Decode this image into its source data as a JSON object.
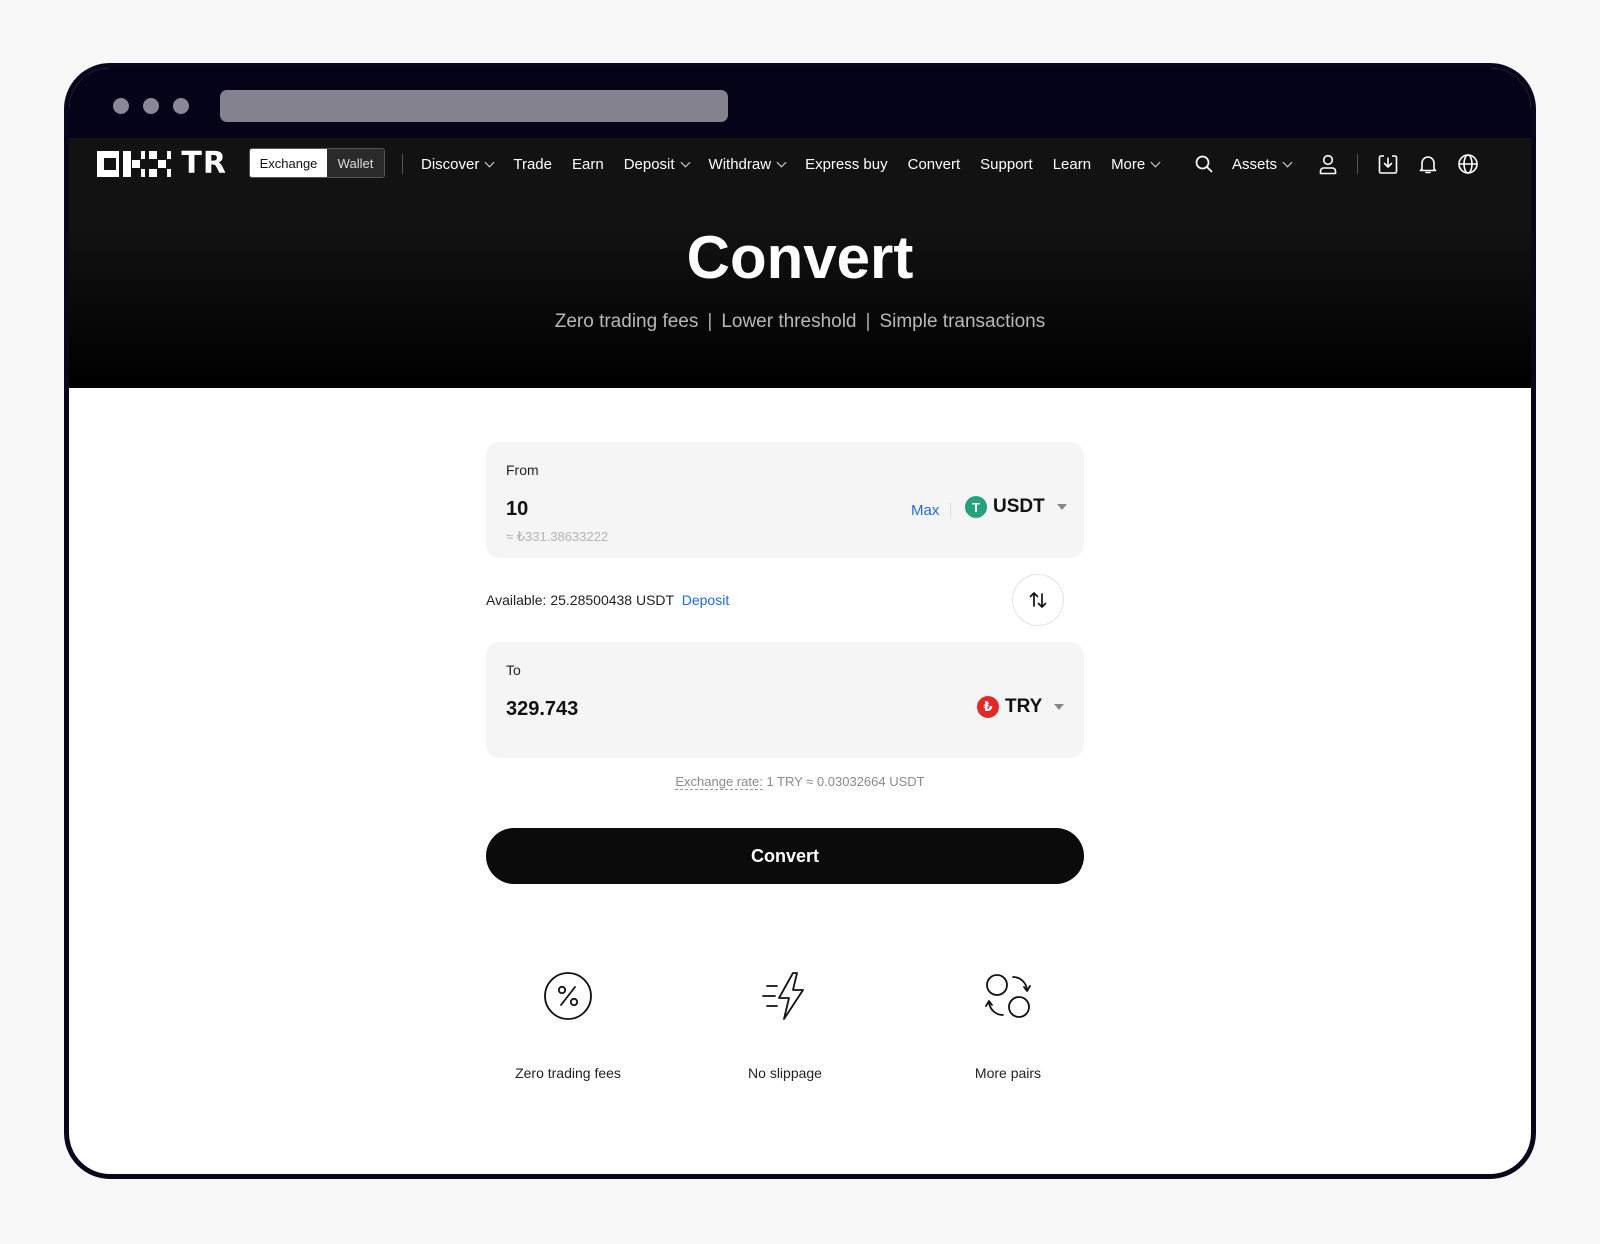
{
  "nav": {
    "segment": {
      "exchange": "Exchange",
      "wallet": "Wallet"
    },
    "items": [
      {
        "label": "Discover",
        "dropdown": true
      },
      {
        "label": "Trade",
        "dropdown": false
      },
      {
        "label": "Earn",
        "dropdown": false
      },
      {
        "label": "Deposit",
        "dropdown": true
      },
      {
        "label": "Withdraw",
        "dropdown": true
      },
      {
        "label": "Express buy",
        "dropdown": false
      },
      {
        "label": "Convert",
        "dropdown": false
      },
      {
        "label": "Support",
        "dropdown": false
      },
      {
        "label": "Learn",
        "dropdown": false
      },
      {
        "label": "More",
        "dropdown": true
      }
    ],
    "assets": "Assets",
    "icons": [
      "search-icon",
      "user-icon",
      "download-icon",
      "bell-icon",
      "globe-icon"
    ]
  },
  "hero": {
    "title": "Convert",
    "features": [
      "Zero trading fees",
      "Lower threshold",
      "Simple transactions"
    ],
    "separator": "|"
  },
  "from": {
    "label": "From",
    "amount": "10",
    "fiat": "≈ ₺331.38633222",
    "max": "Max",
    "coin": "USDT",
    "coin_glyph": "T",
    "coin_color": "#26a17b"
  },
  "available": {
    "text": "Available: 25.28500438 USDT",
    "deposit": "Deposit"
  },
  "to": {
    "label": "To",
    "amount": "329.743",
    "coin": "TRY",
    "coin_glyph": "₺",
    "coin_color": "#e02a2a"
  },
  "rate": {
    "label": "Exchange rate:",
    "value": "1 TRY ≈ 0.03032664 USDT"
  },
  "cta": {
    "label": "Convert"
  },
  "features": [
    {
      "icon": "percent-icon",
      "label": "Zero trading fees"
    },
    {
      "icon": "lightning-icon",
      "label": "No slippage"
    },
    {
      "icon": "pairs-icon",
      "label": "More pairs"
    }
  ],
  "colors": {
    "accent_link": "#1f6ae6",
    "primary_button": "#0b0b0b",
    "hero_bg": "#121212"
  }
}
